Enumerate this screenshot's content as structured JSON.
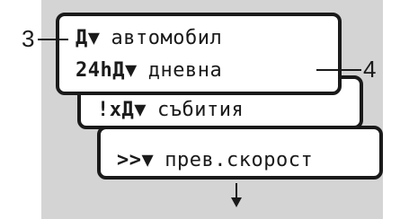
{
  "screens": [
    {
      "symbol": "Д▼",
      "text": "автомобил"
    },
    {
      "symbol": "24hД▼",
      "text": "дневна"
    },
    {
      "symbol": "!xД▼",
      "text": "събития"
    },
    {
      "symbol": ">>▼",
      "text": "прев.скорост"
    }
  ],
  "callouts": {
    "left": "3",
    "right": "4"
  },
  "arrow_icon": "down-arrow-icon"
}
